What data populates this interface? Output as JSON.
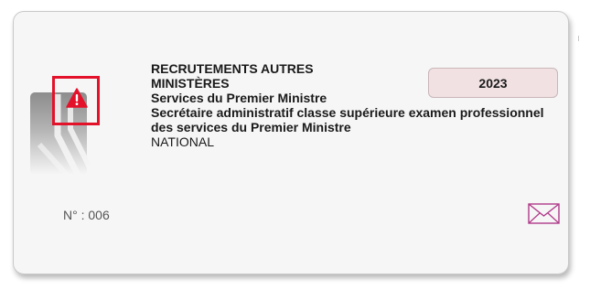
{
  "card": {
    "category": "RECRUTEMENTS AUTRES MINISTÈRES",
    "organization": "Services du Premier Ministre",
    "exam_title": "Secrétaire administratif classe supérieure examen professionnel des services du Premier Ministre",
    "scope": "NATIONAL",
    "year": "2023",
    "number_label": "N° : 006"
  },
  "icons": {
    "alert": "warning-triangle-icon",
    "emblem": "category-emblem-icon",
    "mail": "envelope-icon"
  },
  "colors": {
    "alert_red": "#e3122a",
    "year_badge_bg": "#f1e1e3",
    "mail_magenta": "#b03a8a"
  }
}
